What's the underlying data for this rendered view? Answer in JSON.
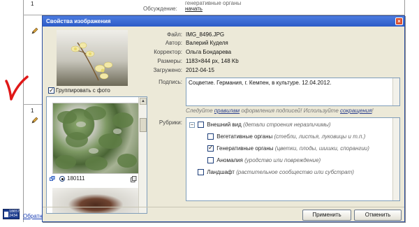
{
  "background": {
    "row1_number": "1",
    "row2_number": "1",
    "organs_text": "генеративные органы",
    "discussion_label": "Обсуждение:",
    "discussion_link": "начать",
    "counter_line1": "18657",
    "counter_line2": "2434",
    "feedback_link": "Обратна"
  },
  "dialog": {
    "title": "Свойства изображения",
    "close_glyph": "×",
    "group_label": "Группировать с фото",
    "photo_id": "180111",
    "meta": [
      {
        "label": "Файл:",
        "value": "IMG_8496.JPG"
      },
      {
        "label": "Автор:",
        "value": "Валерий Куделя"
      },
      {
        "label": "Корректор:",
        "value": "Ольга Бондарева"
      },
      {
        "label": "Размеры:",
        "value": "1183×844 px, 148 Kb"
      },
      {
        "label": "Загружено:",
        "value": "2012-04-15"
      }
    ],
    "caption_label": "Подпись:",
    "caption_text": "Соцветие. Германия, г. Кемпен, в культуре. 12.04.2012.",
    "hint": {
      "p1": "Следуйте ",
      "rules": "правилам",
      "p2": " оформления подписей! Используйте ",
      "abbr": "сокращения",
      "p3": "!"
    },
    "rubrics_label": "Рубрики:",
    "rubrics": [
      {
        "name": "Внешний вид",
        "note": "(детали строения неразличимы)",
        "checked": false
      },
      {
        "name": "Вегетативные органы",
        "note": "(стебли, листья, луковицы и т.п.)",
        "checked": false
      },
      {
        "name": "Генеративные органы",
        "note": "(цветки, плоды, шишки, спорангии)",
        "checked": true
      },
      {
        "name": "Аномалия",
        "note": "(уродство или повреждение)",
        "checked": false
      },
      {
        "name": "Ландшафт",
        "note": "(растительное сообщество или субстрат)",
        "checked": false
      }
    ],
    "tree_toggle": "−",
    "apply_label": "Применить",
    "cancel_label": "Отменить"
  },
  "colors": {
    "titlebar": "#2c5bc7",
    "dialog_bg": "#ece9d8",
    "link": "#1a3fb5",
    "red_mark": "#e01818"
  },
  "icons": [
    "pencil-icon",
    "close-icon",
    "checkbox-icon",
    "link-icon",
    "copy-icon",
    "counter-icon",
    "flower-photo",
    "plant-photo"
  ]
}
